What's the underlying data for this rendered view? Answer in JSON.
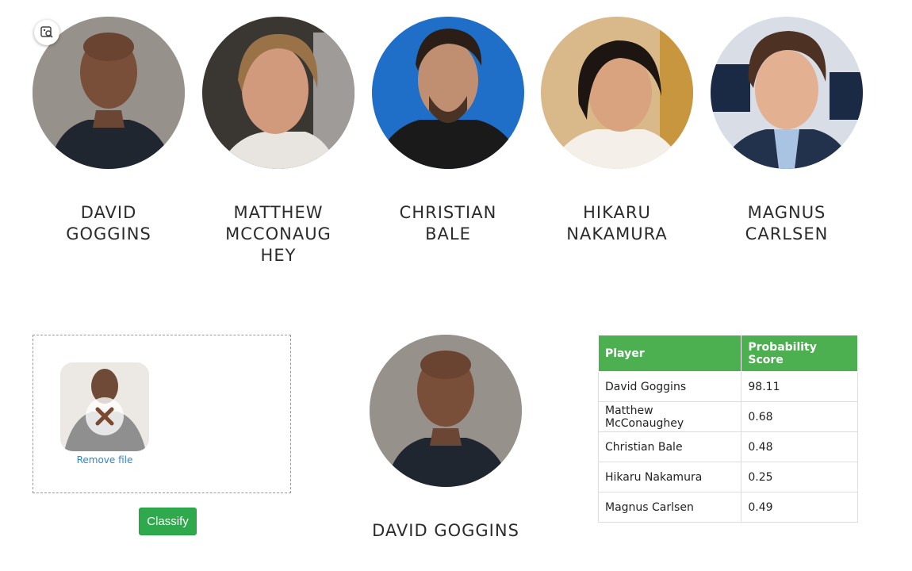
{
  "gallery": [
    {
      "name_line1": "DAVID",
      "name_line2": "GOGGINS",
      "name_line3": ""
    },
    {
      "name_line1": "MATTHEW",
      "name_line2": "MCCONAUG",
      "name_line3": "HEY"
    },
    {
      "name_line1": "CHRISTIAN",
      "name_line2": "BALE",
      "name_line3": ""
    },
    {
      "name_line1": "HIKARU",
      "name_line2": "NAKAMURA",
      "name_line3": ""
    },
    {
      "name_line1": "MAGNUS",
      "name_line2": "CARLSEN",
      "name_line3": ""
    }
  ],
  "lens_icon": "image-search-icon",
  "upload": {
    "remove_label": "Remove file",
    "remove_icon": "close-icon"
  },
  "classify_label": "Classify",
  "result": {
    "name": "DAVID GOGGINS"
  },
  "table": {
    "headers": [
      "Player",
      "Probability Score"
    ],
    "rows": [
      [
        "David Goggins",
        "98.11"
      ],
      [
        "Matthew McConaughey",
        "0.68"
      ],
      [
        "Christian Bale",
        "0.48"
      ],
      [
        "Hikaru Nakamura",
        "0.25"
      ],
      [
        "Magnus Carlsen",
        "0.49"
      ]
    ]
  },
  "colors": {
    "accent_green": "#4caf50",
    "button_green": "#2eaa4c",
    "link_blue": "#2a86d6"
  }
}
